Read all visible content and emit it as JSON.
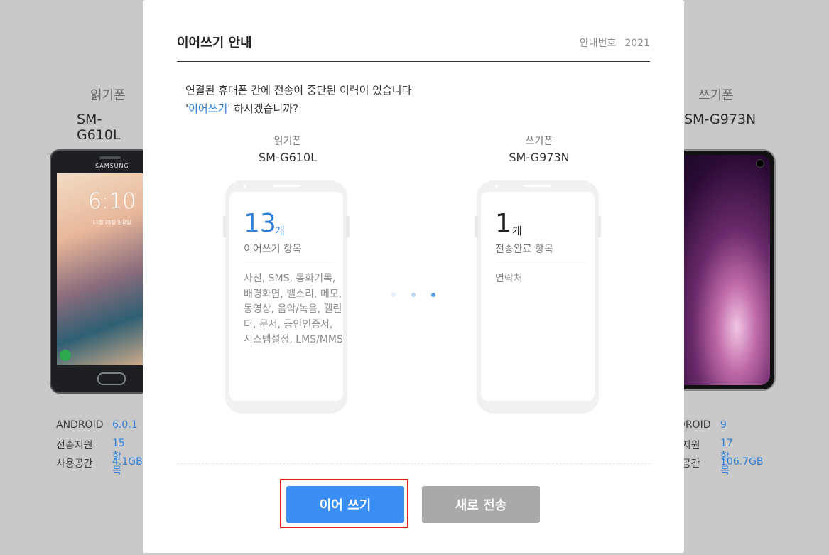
{
  "background": {
    "left": {
      "role": "읽기폰",
      "model": "SM-G610L",
      "phone_brand": "SAMSUNG",
      "lock_time": "6:10",
      "lock_date": "11월 25일 일요일",
      "specs": [
        {
          "key": "ANDROID",
          "value": "6.0.1"
        },
        {
          "key": "전송지원",
          "value": "15항목"
        },
        {
          "key": "사용공간",
          "value": "4.1GB"
        }
      ]
    },
    "right": {
      "role": "쓰기폰",
      "model": "SM-G973N",
      "specs": [
        {
          "key": "ANDROID",
          "value": "9"
        },
        {
          "key": "전송지원",
          "value": "17항목"
        },
        {
          "key": "사용공간",
          "value": "106.7GB"
        }
      ]
    }
  },
  "modal": {
    "title": "이어쓰기 안내",
    "notice_label": "안내번호",
    "notice_number": "2021",
    "message_line1": "연결된 휴대폰 간에 전송이 중단된 이력이 있습니다",
    "message_quote_open": "'",
    "message_highlight": "이어쓰기",
    "message_quote_close": "'",
    "message_rest": " 하시겠습니까?",
    "read_phone": {
      "role": "읽기폰",
      "model": "SM-G610L",
      "count": "13",
      "unit": "개",
      "label": "이어쓰기 항목",
      "items": "사진, SMS, 통화기록, 배경화면, 벨소리, 메모, 동영상, 음악/녹음, 캘린더, 문서, 공인인증서, 시스템설정, LMS/MMS",
      "count_color": "#2f7fd6"
    },
    "write_phone": {
      "role": "쓰기폰",
      "model": "SM-G973N",
      "count": "1",
      "unit": "개",
      "label": "전송완료 항목",
      "items": "연락처",
      "count_color": "#222222"
    },
    "buttons": {
      "continue": "이어 쓰기",
      "new_transfer": "새로 전송"
    },
    "colors": {
      "continue_button": "#3a8ef6",
      "new_transfer_button": "#a9a9a9",
      "highlight_box": "#e01f1f",
      "accent": "#2f7fd6"
    }
  }
}
